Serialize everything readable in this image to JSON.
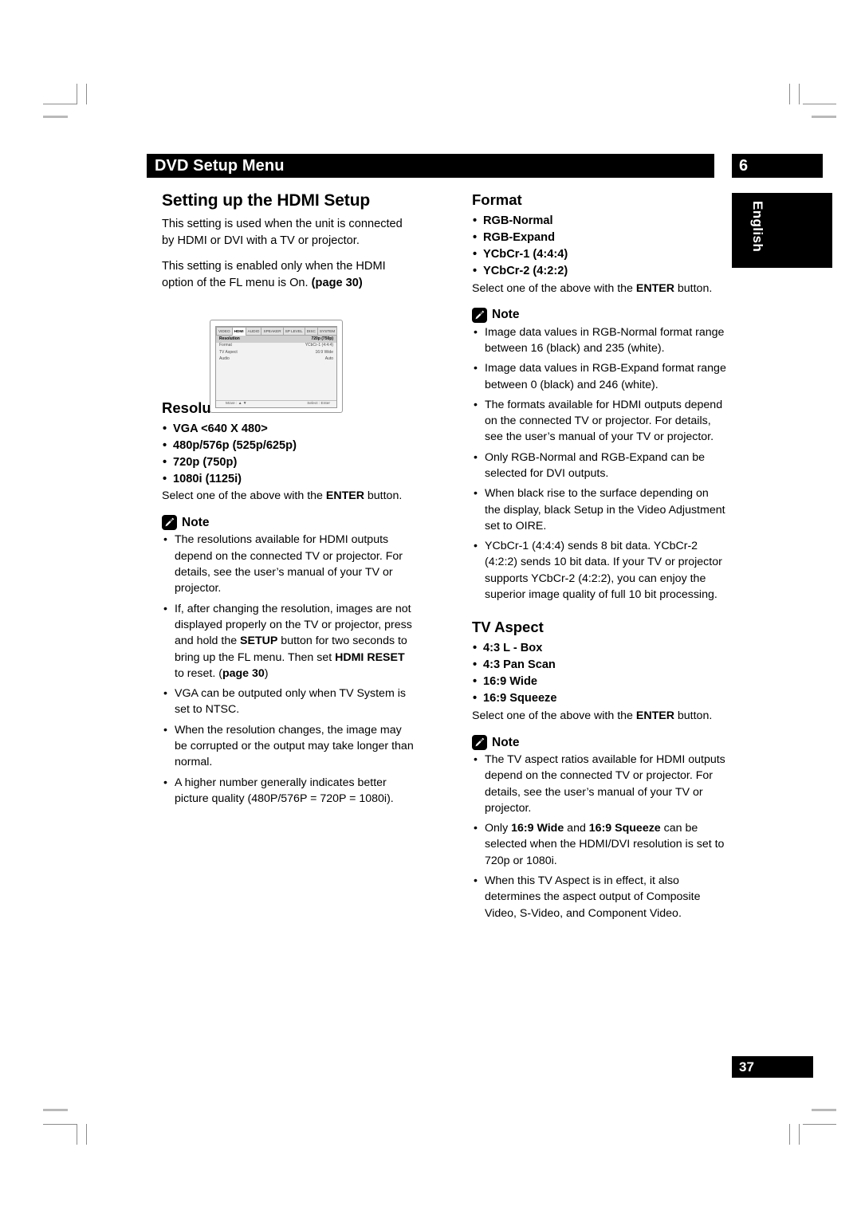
{
  "header": {
    "title": "DVD Setup Menu",
    "chapter": "6",
    "language_tab": "English"
  },
  "footer": {
    "page_number": "37"
  },
  "left_column": {
    "section_title": "Setting up the HDMI Setup",
    "intro_paragraph_1": "This setting is used when the unit is connected by HDMI or DVI with a TV or projector.",
    "intro_paragraph_2_prefix": "This setting is enabled only when the HDMI option of the FL menu is On. ",
    "intro_paragraph_2_pageref": "(page 30)",
    "resolution": {
      "title": "Resolution",
      "options": [
        "VGA <640 X 480>",
        "480p/576p (525p/625p)",
        "720p (750p)",
        "1080i (1125i)"
      ],
      "select_prefix": "Select one of the above with the ",
      "select_bold": "ENTER",
      "select_suffix": " button."
    },
    "note": {
      "label": "Note",
      "items": [
        {
          "parts": [
            {
              "t": "The resolutions available for HDMI outputs depend on the connected TV or projector. For details, see the user’s manual of your TV or projector.",
              "b": false
            }
          ]
        },
        {
          "parts": [
            {
              "t": "If, after changing the resolution, images are not displayed properly on the TV or projector, press and hold the ",
              "b": false
            },
            {
              "t": "SETUP",
              "b": true
            },
            {
              "t": " button for two seconds to bring up the FL menu. Then set ",
              "b": false
            },
            {
              "t": "HDMI RESET",
              "b": true
            },
            {
              "t": " to reset. (",
              "b": false
            },
            {
              "t": "page 30",
              "b": true
            },
            {
              "t": ")",
              "b": false
            }
          ]
        },
        {
          "parts": [
            {
              "t": "VGA can be outputed only when TV System is set to NTSC.",
              "b": false
            }
          ]
        },
        {
          "parts": [
            {
              "t": "When the resolution changes, the image may be corrupted or the output may take longer than normal.",
              "b": false
            }
          ]
        },
        {
          "parts": [
            {
              "t": "A higher number generally indicates better picture quality (480P/576P =  720P = 1080i).",
              "b": false
            }
          ]
        }
      ]
    }
  },
  "right_column": {
    "format": {
      "title": "Format",
      "options": [
        "RGB-Normal",
        "RGB-Expand",
        "YCbCr-1 (4:4:4)",
        "YCbCr-2 (4:2:2)"
      ],
      "select_prefix": "Select one of the above with the ",
      "select_bold": "ENTER",
      "select_suffix": " button."
    },
    "format_note": {
      "label": "Note",
      "items": [
        {
          "parts": [
            {
              "t": "Image data values in RGB-Normal format range between 16 (black) and 235 (white).",
              "b": false
            }
          ]
        },
        {
          "parts": [
            {
              "t": "Image data values in RGB-Expand format range between 0 (black) and 246 (white).",
              "b": false
            }
          ]
        },
        {
          "parts": [
            {
              "t": "The formats available for HDMI outputs depend on the connected TV or projector. For details, see the user’s manual of your TV or projector.",
              "b": false
            }
          ]
        },
        {
          "parts": [
            {
              "t": "Only RGB-Normal and RGB-Expand can be selected for DVI outputs.",
              "b": false
            }
          ]
        },
        {
          "parts": [
            {
              "t": "When black rise to the surface depending on the display, black Setup in the Video Adjustment set to OIRE.",
              "b": false
            }
          ]
        },
        {
          "parts": [
            {
              "t": "YCbCr-1 (4:4:4) sends 8 bit data. YCbCr-2 (4:2:2) sends 10 bit data. If your TV or projector supports YCbCr-2 (4:2:2), you can enjoy the superior image quality of full 10 bit processing.",
              "b": false
            }
          ]
        }
      ]
    },
    "tv_aspect": {
      "title": "TV Aspect",
      "options": [
        "4:3 L - Box",
        "4:3 Pan Scan",
        "16:9 Wide",
        "16:9 Squeeze"
      ],
      "select_prefix": "Select one of the above with the ",
      "select_bold": "ENTER",
      "select_suffix": " button."
    },
    "tv_aspect_note": {
      "label": "Note",
      "items": [
        {
          "parts": [
            {
              "t": "The TV aspect ratios available for HDMI outputs depend on the connected TV or projector. For details, see the user’s manual of your TV or projector.",
              "b": false
            }
          ]
        },
        {
          "parts": [
            {
              "t": "Only ",
              "b": false
            },
            {
              "t": "16:9 Wide",
              "b": true
            },
            {
              "t": " and ",
              "b": false
            },
            {
              "t": "16:9 Squeeze",
              "b": true
            },
            {
              "t": " can be selected when the HDMI/DVI resolution is set to 720p or 1080i.",
              "b": false
            }
          ]
        },
        {
          "parts": [
            {
              "t": "When this TV Aspect is in effect, it also determines the aspect output of Composite Video, S-Video, and Component Video.",
              "b": false
            }
          ]
        }
      ]
    }
  },
  "osd_figure": {
    "tabs": [
      {
        "label": "VIDEO",
        "active": false
      },
      {
        "label": "HDMI",
        "active": true
      },
      {
        "label": "AUDIO",
        "active": false
      },
      {
        "label": "SPEAKER",
        "active": false
      },
      {
        "label": "SP LEVEL",
        "active": false
      },
      {
        "label": "DISC",
        "active": false
      },
      {
        "label": "SYSTEM",
        "active": false
      }
    ],
    "rows": [
      {
        "label": "Resolution",
        "value": "720p (750p)",
        "selected": true
      },
      {
        "label": "Format",
        "value": "YCbCr-1 (4:4:4)",
        "selected": false
      },
      {
        "label": "TV Aspect",
        "value": "16:9 Wide",
        "selected": false
      },
      {
        "label": "Audio",
        "value": "Auto",
        "selected": false
      }
    ],
    "footer_left": "Move : ▲ ▼",
    "footer_right": "Select : Enter"
  }
}
